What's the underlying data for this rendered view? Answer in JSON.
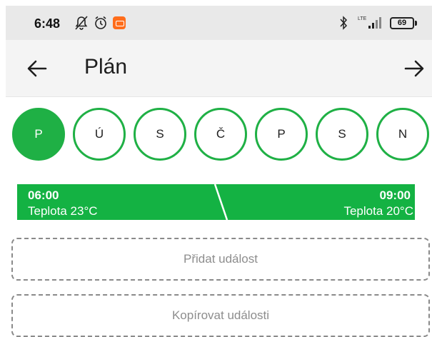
{
  "status_bar": {
    "time": "6:48",
    "lte": "LTE",
    "battery": "69",
    "icons": [
      "bell-off-icon",
      "alarm-icon",
      "app-notification-icon",
      "bluetooth-icon",
      "signal-icon",
      "battery-icon"
    ]
  },
  "header": {
    "title": "Plán",
    "back_icon": "arrow-left-icon",
    "forward_icon": "arrow-right-icon"
  },
  "days": [
    {
      "label": "P",
      "active": true
    },
    {
      "label": "Ú",
      "active": false
    },
    {
      "label": "S",
      "active": false
    },
    {
      "label": "Č",
      "active": false
    },
    {
      "label": "P",
      "active": false
    },
    {
      "label": "S",
      "active": false
    },
    {
      "label": "N",
      "active": false
    }
  ],
  "event": {
    "start_time": "06:00",
    "start_temp": "Teplota 23°C",
    "end_time": "09:00",
    "end_temp": "Teplota 20°C"
  },
  "actions": {
    "add_event": "Přidat událost",
    "copy_events": "Kopírovat události"
  },
  "colors": {
    "accent": "#1fb045",
    "status_bar": "#e9e9e9",
    "app_bar": "#f4f4f4"
  }
}
